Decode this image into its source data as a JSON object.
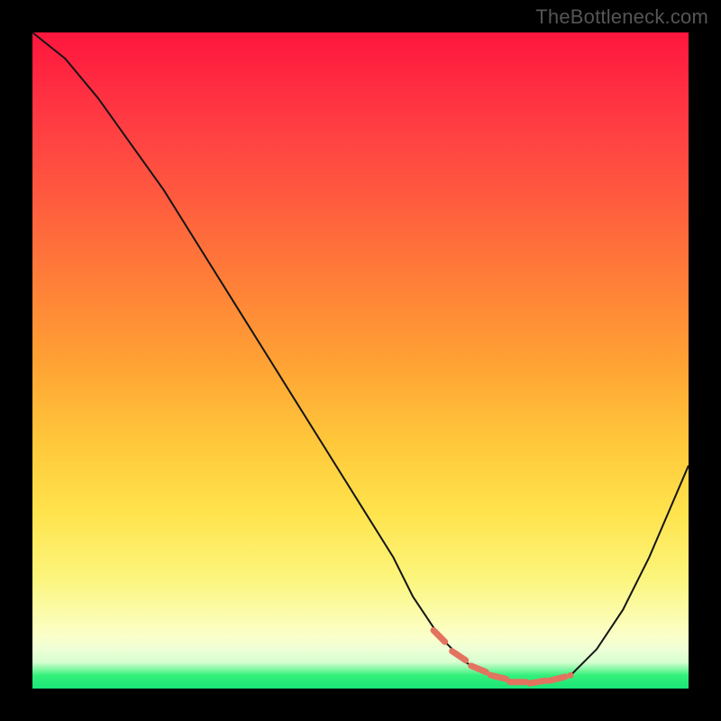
{
  "watermark": "TheBottleneck.com",
  "chart_data": {
    "type": "line",
    "title": "",
    "xlabel": "",
    "ylabel": "",
    "xlim": [
      0,
      1
    ],
    "ylim": [
      0,
      1
    ],
    "x": [
      0.0,
      0.05,
      0.1,
      0.15,
      0.2,
      0.25,
      0.3,
      0.35,
      0.4,
      0.45,
      0.5,
      0.55,
      0.58,
      0.62,
      0.66,
      0.7,
      0.74,
      0.78,
      0.82,
      0.86,
      0.9,
      0.94,
      0.97,
      1.0
    ],
    "values": [
      1.0,
      0.96,
      0.9,
      0.83,
      0.76,
      0.68,
      0.6,
      0.52,
      0.44,
      0.36,
      0.28,
      0.2,
      0.14,
      0.08,
      0.04,
      0.02,
      0.01,
      0.01,
      0.02,
      0.06,
      0.12,
      0.2,
      0.27,
      0.34
    ],
    "minimum_index_range": [
      0.62,
      0.82
    ],
    "dash_points_x": [
      0.62,
      0.65,
      0.68,
      0.71,
      0.74,
      0.77,
      0.8,
      0.82
    ],
    "dash_color": "#e2735f",
    "gradient_zones": [
      {
        "label": "red",
        "from": 0.0,
        "to": 0.18
      },
      {
        "label": "orange",
        "from": 0.18,
        "to": 0.55
      },
      {
        "label": "yellow",
        "from": 0.55,
        "to": 0.88
      },
      {
        "label": "pale",
        "from": 0.88,
        "to": 0.96
      },
      {
        "label": "green",
        "from": 0.96,
        "to": 1.0
      }
    ]
  },
  "colors": {
    "frame": "#000000",
    "watermark_text": "#555555",
    "curve": "#151515",
    "dash": "#e2735f"
  }
}
